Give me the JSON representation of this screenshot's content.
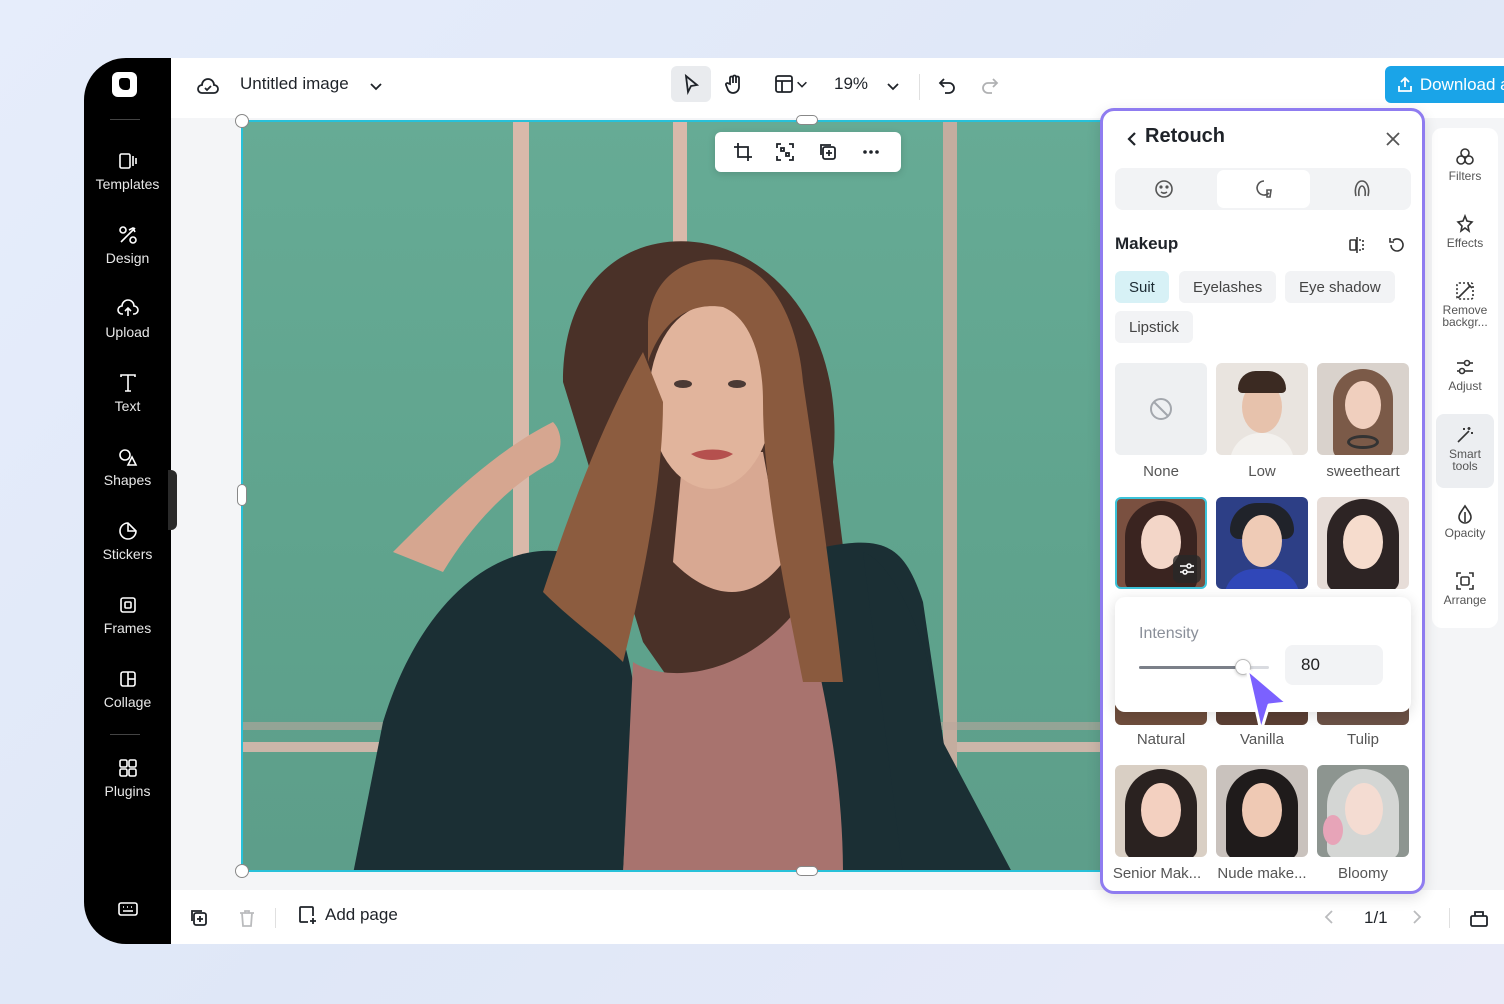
{
  "sidebar": {
    "items": [
      {
        "label": "Templates",
        "icon": "templates-icon"
      },
      {
        "label": "Design",
        "icon": "design-icon"
      },
      {
        "label": "Upload",
        "icon": "upload-icon"
      },
      {
        "label": "Text",
        "icon": "text-icon"
      },
      {
        "label": "Shapes",
        "icon": "shapes-icon"
      },
      {
        "label": "Stickers",
        "icon": "stickers-icon"
      },
      {
        "label": "Frames",
        "icon": "frames-icon"
      },
      {
        "label": "Collage",
        "icon": "collage-icon"
      },
      {
        "label": "Plugins",
        "icon": "plugins-icon"
      }
    ]
  },
  "header": {
    "title": "Untitled image",
    "zoom": "19%",
    "download_label": "Download all"
  },
  "bottombar": {
    "add_page_label": "Add page",
    "page_indicator": "1/1"
  },
  "rail": {
    "items": [
      {
        "label": "Filters",
        "icon": "filters-icon"
      },
      {
        "label": "Effects",
        "icon": "effects-icon"
      },
      {
        "label": "Remove backgr...",
        "icon": "remove-background-icon"
      },
      {
        "label": "Adjust",
        "icon": "adjust-icon"
      },
      {
        "label": "Smart tools",
        "icon": "smart-tools-icon"
      },
      {
        "label": "Opacity",
        "icon": "opacity-icon"
      },
      {
        "label": "Arrange",
        "icon": "arrange-icon"
      }
    ]
  },
  "retouch": {
    "title": "Retouch",
    "section_title": "Makeup",
    "chips": [
      "Suit",
      "Eyelashes",
      "Eye shadow",
      "Lipstick"
    ],
    "presets_row1": [
      "None",
      "Low",
      "sweetheart"
    ],
    "presets_row3": [
      "Natural",
      "Vanilla",
      "Tulip"
    ],
    "presets_row4": [
      "Senior Mak...",
      "Nude make...",
      "Bloomy"
    ],
    "intensity_label": "Intensity",
    "intensity_value": "80",
    "intensity_fraction": 0.8
  },
  "colors": {
    "accent": "#1aa4e8",
    "panel_border": "#8f7cf0",
    "selection": "#27c1d9",
    "chip_active": "#d7f1f6"
  }
}
